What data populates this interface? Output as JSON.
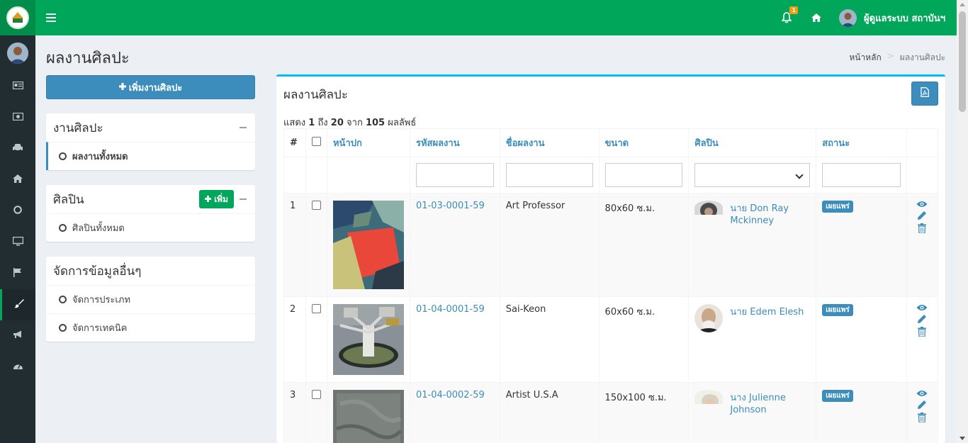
{
  "topbar": {
    "notification_count": "1",
    "user_name": "ผู้ดูแลระบบ สถาบันฯ",
    "colors": {
      "bar": "#00a65a",
      "badge": "#f39c12"
    }
  },
  "sidebar": {
    "icons": [
      "id-card-icon",
      "money-icon",
      "car-icon",
      "home-icon",
      "circle-icon",
      "monitor-icon",
      "flag-icon",
      "paint-brush-icon",
      "megaphone-icon",
      "dashboard-icon"
    ],
    "active": "paint-brush-icon"
  },
  "page": {
    "title": "ผลงานศิลปะ",
    "breadcrumb_home": "หน้าหลัก",
    "breadcrumb_sep": ">",
    "breadcrumb_current": "ผลงานศิลปะ"
  },
  "left": {
    "add_artwork_label": "เพิ่มงานศิลปะ",
    "artwork_box": {
      "title": "งานศิลปะ",
      "items": [
        "ผลงานทั้งหมด"
      ]
    },
    "artist_box": {
      "title": "ศิลปิน",
      "add_label": "เพิ่ม",
      "items": [
        "ศิลปินทั้งหมด"
      ]
    },
    "other_box": {
      "title": "จัดการข้อมูลอื่นๆ",
      "items": [
        "จัดการประเภท",
        "จัดการเทคนิค"
      ]
    }
  },
  "main": {
    "title": "ผลงานศิลปะ",
    "summary": {
      "prefix": "แสดง",
      "from": "1",
      "to_word": "ถึง",
      "to": "20",
      "of_word": "จาก",
      "total": "105",
      "suffix": "ผลลัพธ์"
    },
    "columns": [
      "#",
      "หน้าปก",
      "รหัสผลงาน",
      "ชื่อผลงาน",
      "ขนาด",
      "ศิลปิน",
      "สถานะ"
    ],
    "rows": [
      {
        "num": "1",
        "code": "01-03-0001-59",
        "name": "Art Professor",
        "size": "80x60 ซ.ม.",
        "artist": "นาย Don Ray Mckinney",
        "status": "เผยแพร่"
      },
      {
        "num": "2",
        "code": "01-04-0001-59",
        "name": "Sai-Keon",
        "size": "60x60 ซ.ม.",
        "artist": "นาย Edem Elesh",
        "status": "เผยแพร่"
      },
      {
        "num": "3",
        "code": "01-04-0002-59",
        "name": "Artist U.S.A",
        "size": "150x100 ซ.ม.",
        "artist": "นาง Julienne Johnson",
        "status": "เผยแพร่"
      }
    ]
  }
}
